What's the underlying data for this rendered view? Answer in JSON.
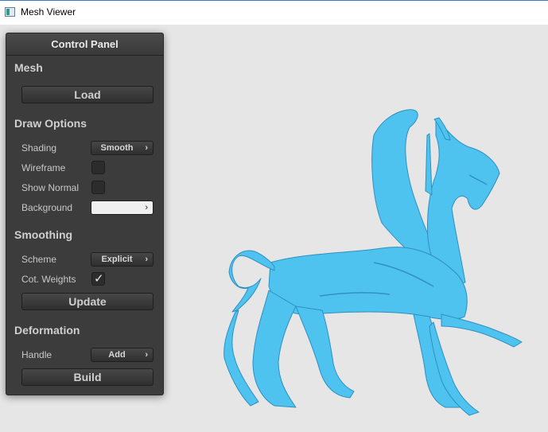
{
  "window": {
    "title": "Mesh Viewer"
  },
  "panel": {
    "title": "Control Panel",
    "mesh": {
      "heading": "Mesh",
      "load_label": "Load"
    },
    "draw_options": {
      "heading": "Draw Options",
      "shading_label": "Shading",
      "shading_value": "Smooth",
      "wireframe_label": "Wireframe",
      "wireframe_checked": false,
      "show_normal_label": "Show Normal",
      "show_normal_checked": false,
      "background_label": "Background",
      "background_color": "#f0f0f0"
    },
    "smoothing": {
      "heading": "Smoothing",
      "scheme_label": "Scheme",
      "scheme_value": "Explicit",
      "cot_weights_label": "Cot. Weights",
      "cot_weights_checked": true,
      "update_label": "Update"
    },
    "deformation": {
      "heading": "Deformation",
      "handle_label": "Handle",
      "handle_value": "Add",
      "build_label": "Build"
    }
  },
  "viewport": {
    "mesh_color": "#4fc3f0",
    "mesh_shadow": "#2f8fc0",
    "background": "#e6e6e6"
  },
  "icons": {
    "chevron": "›",
    "check": "✓"
  }
}
